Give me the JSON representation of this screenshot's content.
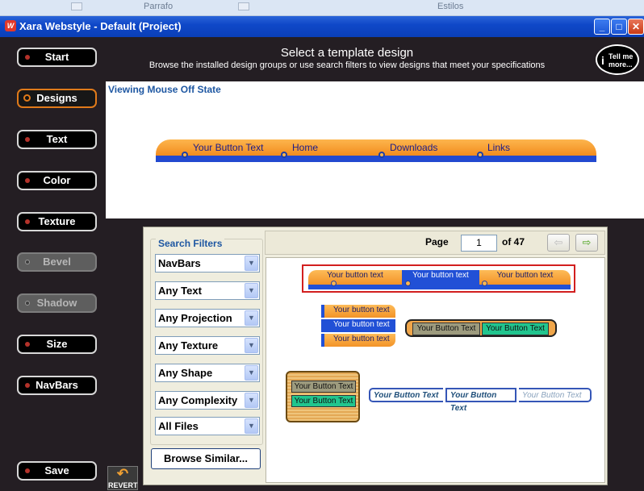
{
  "background_app": {
    "cells": [
      "Parrafo",
      "Estilos"
    ]
  },
  "window": {
    "title": "Xara Webstyle - Default (Project)",
    "icon": "xara-logo-icon",
    "controls": [
      "minimize",
      "maximize",
      "close"
    ]
  },
  "header": {
    "title": "Select a template design",
    "subtitle": "Browse the installed design groups or use search filters to view designs that meet your specifications",
    "tell_me_more": "Tell me more..."
  },
  "nav": [
    {
      "label": "Start",
      "state": "normal"
    },
    {
      "label": "Designs",
      "state": "active"
    },
    {
      "label": "Text",
      "state": "normal"
    },
    {
      "label": "Color",
      "state": "normal"
    },
    {
      "label": "Texture",
      "state": "normal"
    },
    {
      "label": "Bevel",
      "state": "disabled"
    },
    {
      "label": "Shadow",
      "state": "disabled"
    },
    {
      "label": "Size",
      "state": "normal"
    },
    {
      "label": "NavBars",
      "state": "normal"
    },
    {
      "label": "Save",
      "state": "normal"
    }
  ],
  "preview": {
    "label": "Viewing Mouse Off State",
    "buttons": [
      "Your Button Text",
      "Home",
      "Downloads",
      "Links"
    ]
  },
  "filters": {
    "title": "Search Filters",
    "selects": [
      "NavBars",
      "Any Text",
      "Any Projection",
      "Any Texture",
      "Any Shape",
      "Any Complexity",
      "All Files"
    ],
    "browse_similar": "Browse Similar..."
  },
  "pagination": {
    "label": "Page",
    "current": "1",
    "of_label": "of 47",
    "prev": "⇦",
    "next": "⇨"
  },
  "gallery": {
    "hbar": [
      "Your button text",
      "Your button text",
      "Your button text"
    ],
    "vbar": [
      "Your button text",
      "Your button text",
      "Your button text"
    ],
    "pill": [
      "Your Button Text",
      "Your Button Text"
    ],
    "gold": [
      "Your Button Text",
      "Your Button Text"
    ],
    "bracket": [
      "Your Button Text",
      "Your Button Text",
      "Your Button Text"
    ]
  },
  "revert": "REVERT",
  "colors": {
    "title_blue": "#0f48c8",
    "accent_orange": "#e07a1a",
    "label_blue": "#1e57a2",
    "selection_red": "#d21f1f"
  }
}
